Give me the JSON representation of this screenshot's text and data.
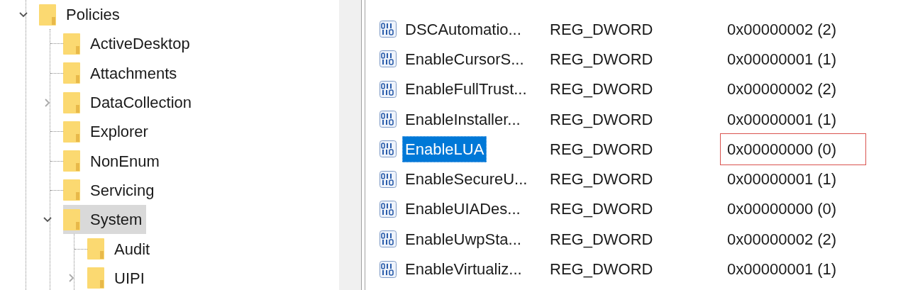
{
  "tree": [
    {
      "label": "Policies",
      "kind": "branch",
      "expanded": true,
      "selected": false,
      "children": [
        {
          "label": "ActiveDesktop",
          "kind": "leaf",
          "selected": false
        },
        {
          "label": "Attachments",
          "kind": "leaf",
          "selected": false
        },
        {
          "label": "DataCollection",
          "kind": "branch",
          "expanded": false,
          "selected": false
        },
        {
          "label": "Explorer",
          "kind": "leaf",
          "selected": false
        },
        {
          "label": "NonEnum",
          "kind": "leaf",
          "selected": false
        },
        {
          "label": "Servicing",
          "kind": "leaf",
          "selected": false
        },
        {
          "label": "System",
          "kind": "branch",
          "expanded": true,
          "selected": true,
          "children": [
            {
              "label": "Audit",
              "kind": "leaf",
              "selected": false
            },
            {
              "label": "UIPI",
              "kind": "branch",
              "expanded": false,
              "selected": false
            }
          ]
        }
      ]
    }
  ],
  "values": [
    {
      "name": "DSCAutomatio...",
      "type": "REG_DWORD",
      "data": "0x00000002 (2)",
      "selected": false,
      "outlined": false
    },
    {
      "name": "EnableCursorS...",
      "type": "REG_DWORD",
      "data": "0x00000001 (1)",
      "selected": false,
      "outlined": false
    },
    {
      "name": "EnableFullTrust...",
      "type": "REG_DWORD",
      "data": "0x00000002 (2)",
      "selected": false,
      "outlined": false
    },
    {
      "name": "EnableInstaller...",
      "type": "REG_DWORD",
      "data": "0x00000001 (1)",
      "selected": false,
      "outlined": false
    },
    {
      "name": "EnableLUA",
      "type": "REG_DWORD",
      "data": "0x00000000 (0)",
      "selected": true,
      "outlined": true
    },
    {
      "name": "EnableSecureU...",
      "type": "REG_DWORD",
      "data": "0x00000001 (1)",
      "selected": false,
      "outlined": false
    },
    {
      "name": "EnableUIADes...",
      "type": "REG_DWORD",
      "data": "0x00000000 (0)",
      "selected": false,
      "outlined": false
    },
    {
      "name": "EnableUwpSta...",
      "type": "REG_DWORD",
      "data": "0x00000002 (2)",
      "selected": false,
      "outlined": false
    },
    {
      "name": "EnableVirtualiz...",
      "type": "REG_DWORD",
      "data": "0x00000001 (1)",
      "selected": false,
      "outlined": false
    }
  ]
}
